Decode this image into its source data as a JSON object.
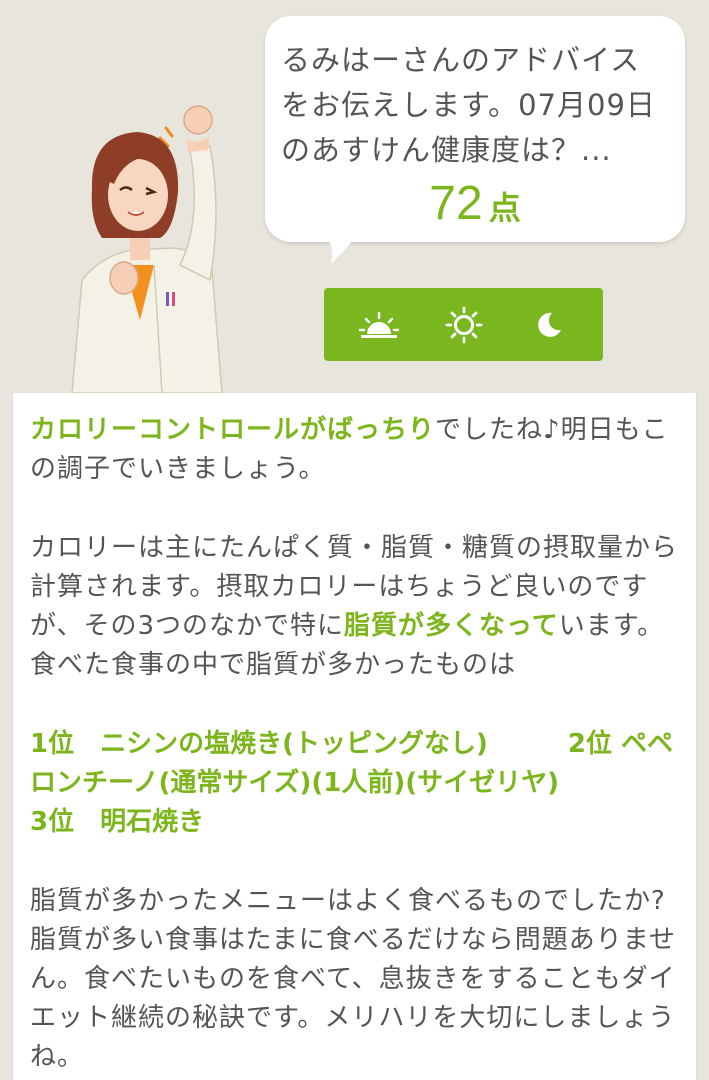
{
  "advice": {
    "intro_text": "るみはーさんのアドバイス\nをお伝えします。07月09日\nのあすけん健康度は？...",
    "score_value": "72",
    "score_unit": "点"
  },
  "time_buttons": [
    {
      "icon": "sunrise-icon"
    },
    {
      "icon": "sun-icon"
    },
    {
      "icon": "moon-icon"
    }
  ],
  "colors": {
    "accent": "#7cb51c",
    "button_bar": "#7ab61e",
    "background": "#e8e6dc",
    "text": "#555555"
  },
  "paragraph1": {
    "highlight": "カロリーコントロールがばっちり",
    "rest": "でしたね♪明日もこの調子でいきましょう。"
  },
  "paragraph2": {
    "before": "カロリーは主にたんぱく質・脂質・糖質の摂取量から計算されます。摂取カロリーはちょうど良いのですが、その3つのなかで特に",
    "highlight": "脂質が多くなって",
    "after": "います。食べた食事の中で脂質が多かったものは"
  },
  "ranking": [
    {
      "rank": "1位",
      "name": "ニシンの塩焼き(トッピングなし)"
    },
    {
      "rank": "2位",
      "name": "ペペロンチーノ(通常サイズ)(1人前)(サイゼリヤ)"
    },
    {
      "rank": "3位",
      "name": "明石焼き"
    }
  ],
  "paragraph3": "脂質が多かったメニューはよく食べるものでしたか?脂質が多い食事はたまに食べるだけなら問題ありません。食べたいものを食べて、息抜きをすることもダイエット継続の秘訣です。メリハリを大切にしましょうね。"
}
